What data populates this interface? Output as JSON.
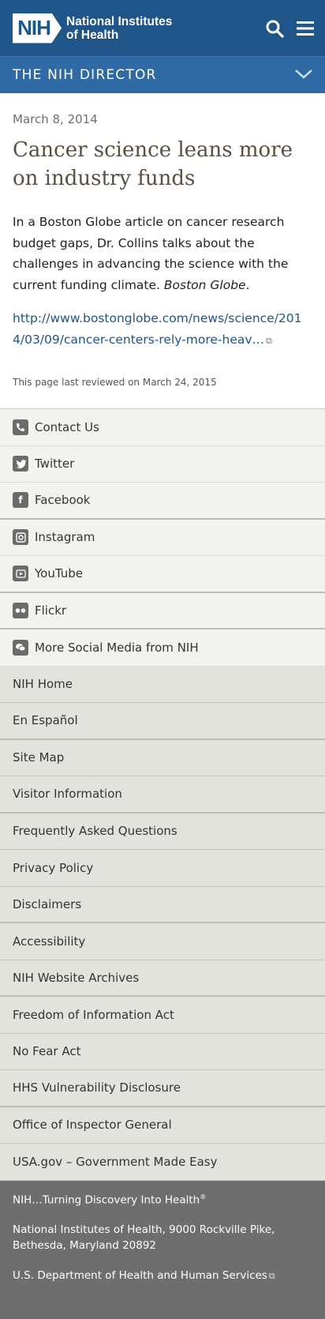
{
  "header": {
    "logo_mark": "NIH",
    "logo_line1": "National Institutes",
    "logo_line2": "of Health",
    "section_title": "THE NIH DIRECTOR"
  },
  "article": {
    "date": "March 8, 2014",
    "headline": "Cancer science leans more on industry funds",
    "body": "In a Boston Globe article on cancer research budget gaps, Dr. Collins talks about the challenges in advancing the science with the current funding climate.",
    "source": "Boston Globe",
    "source_suffix": ".",
    "link_text": "http://www.bostonglobe.com/news/science/2014/03/09/cancer-centers-rely-more-heav…",
    "reviewed": "This page last reviewed on March 24, 2015"
  },
  "social": [
    {
      "label": "Contact Us",
      "icon": "phone-icon"
    },
    {
      "label": "Twitter",
      "icon": "twitter-icon"
    },
    {
      "label": "Facebook",
      "icon": "facebook-icon"
    },
    {
      "label": "Instagram",
      "icon": "instagram-icon"
    },
    {
      "label": "YouTube",
      "icon": "youtube-icon"
    },
    {
      "label": "Flickr",
      "icon": "flickr-icon"
    },
    {
      "label": "More Social Media from NIH",
      "icon": "chat-icon"
    }
  ],
  "links": [
    "NIH Home",
    "En Español",
    "Site Map",
    "Visitor Information",
    "Frequently Asked Questions",
    "Privacy Policy",
    "Disclaimers",
    "Accessibility",
    "NIH Website Archives",
    "Freedom of Information Act",
    "No Fear Act",
    "HHS Vulnerability Disclosure",
    "Office of Inspector General",
    "USA.gov – Government Made Easy"
  ],
  "footer": {
    "tagline": "NIH…Turning Discovery Into Health",
    "tagline_mark": "®",
    "address_line1": "National Institutes of Health, 9000 Rockville Pike,",
    "address_line2": "Bethesda, Maryland 20892",
    "hhs": "U.S. Department of Health and Human Services"
  },
  "colors": {
    "header_blue": "#20558a",
    "section_blue": "#2f6aa5",
    "footer_gray": "#6e6e6e"
  }
}
